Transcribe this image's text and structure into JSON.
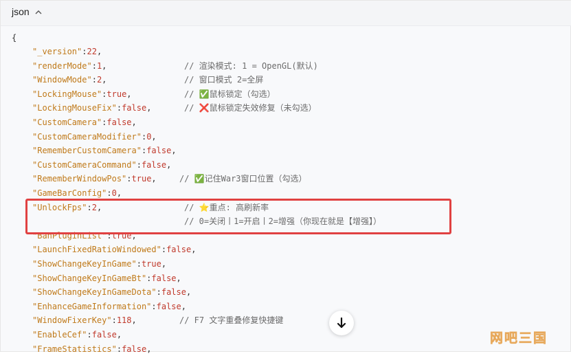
{
  "header": {
    "language": "json"
  },
  "colors": {
    "key": "#c07a1a",
    "number": "#c0392b",
    "keyword": "#c0392b",
    "comment": "#6b6b6b",
    "highlight": "#e04141"
  },
  "code": {
    "open_brace": "{",
    "lines": [
      {
        "key": "_version",
        "value": "22",
        "vtype": "num",
        "comment": ""
      },
      {
        "key": "renderMode",
        "value": "1",
        "vtype": "num",
        "comment": "// 渲染模式: 1 = OpenGL(默认)"
      },
      {
        "key": "WindowMode",
        "value": "2",
        "vtype": "num",
        "comment": "// 窗口模式 2=全屏"
      },
      {
        "key": "LockingMouse",
        "value": "true",
        "vtype": "kw",
        "comment": "// ✅鼠标锁定（勾选）"
      },
      {
        "key": "LockingMouseFix",
        "value": "false",
        "vtype": "kw",
        "comment": "// ❌鼠标锁定失效修复（未勾选）"
      },
      {
        "key": "CustomCamera",
        "value": "false",
        "vtype": "kw",
        "comment": ""
      },
      {
        "key": "CustomCameraModifier",
        "value": "0",
        "vtype": "num",
        "comment": ""
      },
      {
        "key": "RememberCustomCamera",
        "value": "false",
        "vtype": "kw",
        "comment": ""
      },
      {
        "key": "CustomCameraCommand",
        "value": "false",
        "vtype": "kw",
        "comment": ""
      },
      {
        "key": "RememberWindowPos",
        "value": "true",
        "vtype": "kw",
        "comment": "// ✅记住War3窗口位置（勾选）"
      },
      {
        "key": "GameBarConfig",
        "value": "0",
        "vtype": "num",
        "comment": ""
      },
      {
        "key": "UnlockFps",
        "value": "2",
        "vtype": "num",
        "comment": "// ⭐重点: 高刷新率"
      },
      {
        "key": "",
        "value": "",
        "vtype": "",
        "comment": "// 0=关闭丨1=开启丨2=增强（你现在就是【增强】）"
      },
      {
        "key": "BanPluginList",
        "value": "true",
        "vtype": "kw",
        "comment": ""
      },
      {
        "key": "LaunchFixedRatioWindowed",
        "value": "false",
        "vtype": "kw",
        "comment": ""
      },
      {
        "key": "ShowChangeKeyInGame",
        "value": "true",
        "vtype": "kw",
        "comment": ""
      },
      {
        "key": "ShowChangeKeyInGameBt",
        "value": "false",
        "vtype": "kw",
        "comment": ""
      },
      {
        "key": "ShowChangeKeyInGameDota",
        "value": "false",
        "vtype": "kw",
        "comment": ""
      },
      {
        "key": "EnhanceGameInformation",
        "value": "false",
        "vtype": "kw",
        "comment": ""
      },
      {
        "key": "WindowFixerKey",
        "value": "118",
        "vtype": "num",
        "comment": "// F7 文字重叠修复快捷键"
      },
      {
        "key": "EnableCef",
        "value": "false",
        "vtype": "kw",
        "comment": ""
      },
      {
        "key": "FrameStatistics",
        "value": "false",
        "vtype": "kw",
        "comment": ""
      }
    ]
  },
  "watermark": "网吧三国"
}
